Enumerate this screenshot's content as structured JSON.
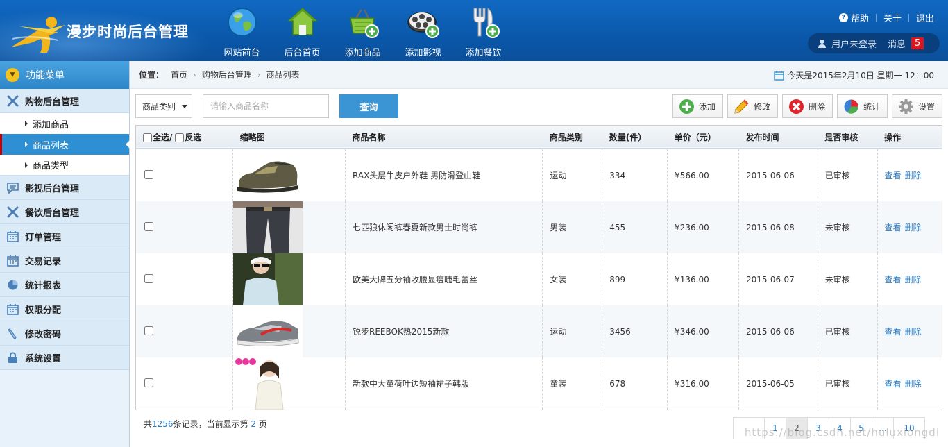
{
  "header": {
    "logo_text": "漫步时尚后台管理",
    "nav": [
      {
        "label": "网站前台",
        "icon": "globe-icon"
      },
      {
        "label": "后台首页",
        "icon": "house-icon"
      },
      {
        "label": "添加商品",
        "icon": "basket-add-icon"
      },
      {
        "label": "添加影视",
        "icon": "film-reel-add-icon"
      },
      {
        "label": "添加餐饮",
        "icon": "fork-knife-add-icon"
      }
    ],
    "top_links": {
      "help": "帮助",
      "about": "关于",
      "exit": "退出"
    },
    "user": {
      "status": "用户未登录",
      "messages_label": "消息",
      "messages_count": "5"
    }
  },
  "sidebar": {
    "title": "功能菜单",
    "groups": [
      {
        "label": "购物后台管理",
        "icon": "tools-icon"
      },
      {
        "label": "影视后台管理",
        "icon": "chat-icon"
      },
      {
        "label": "餐饮后台管理",
        "icon": "tools-icon"
      },
      {
        "label": "订单管理",
        "icon": "calendar-icon"
      },
      {
        "label": "交易记录",
        "icon": "calendar-icon"
      },
      {
        "label": "统计报表",
        "icon": "pie-icon"
      },
      {
        "label": "权限分配",
        "icon": "calendar-icon"
      },
      {
        "label": "修改密码",
        "icon": "pencil-icon"
      },
      {
        "label": "系统设置",
        "icon": "lock-icon"
      }
    ],
    "subitems": [
      "添加商品",
      "商品列表",
      "商品类型"
    ],
    "active_subitem": "商品列表"
  },
  "breadcrumb": {
    "label": "位置：",
    "items": [
      "首页",
      "购物后台管理",
      "商品列表"
    ],
    "date_text": "今天是2015年2月10日 星期一 12：00"
  },
  "toolbar": {
    "category_select": "商品类别",
    "search_placeholder": "请输入商品名称",
    "query_label": "查询",
    "buttons": [
      {
        "label": "添加",
        "icon": "plus-circle-icon"
      },
      {
        "label": "修改",
        "icon": "pencil-icon"
      },
      {
        "label": "删除",
        "icon": "delete-circle-icon"
      },
      {
        "label": "统计",
        "icon": "pie-chart-icon"
      },
      {
        "label": "设置",
        "icon": "gear-icon"
      }
    ]
  },
  "table": {
    "headers": {
      "select_all": "全选/",
      "invert": "反选",
      "thumb": "缩略图",
      "name": "商品名称",
      "category": "商品类别",
      "qty": "数量(件）",
      "price": "单价（元）",
      "date": "发布时间",
      "review": "是否审核",
      "ops": "操作"
    },
    "view_label": "查看",
    "delete_label": "删除",
    "rows": [
      {
        "name": "RAX头层牛皮户外鞋 男防滑登山鞋",
        "category": "运动",
        "qty": "334",
        "price": "¥566.00",
        "date": "2015-06-06",
        "review": "已审核"
      },
      {
        "name": "七匹狼休闲裤春夏新款男士时尚裤",
        "category": "男装",
        "qty": "455",
        "price": "¥236.00",
        "date": "2015-06-08",
        "review": "未审核"
      },
      {
        "name": "欧美大牌五分袖收腰显瘦睫毛蕾丝",
        "category": "女装",
        "qty": "899",
        "price": "¥136.00",
        "date": "2015-06-07",
        "review": "未审核"
      },
      {
        "name": "锐步REEBOK热2015新款",
        "category": "运动",
        "qty": "3456",
        "price": "¥346.00",
        "date": "2015-06-06",
        "review": "已审核"
      },
      {
        "name": "新款中大童荷叶边短袖裙子韩版",
        "category": "童装",
        "qty": "678",
        "price": "¥316.00",
        "date": "2015-06-05",
        "review": "已审核"
      }
    ]
  },
  "footer": {
    "prefix": "共",
    "total": "1256",
    "mid": "条记录，当前显示第",
    "page": "2",
    "suffix": "页",
    "pages": [
      "1",
      "2",
      "3",
      "4",
      "5",
      "...",
      "10"
    ],
    "current_page": "2",
    "watermark": "https://blog.csdn.net/huluxiongdi"
  }
}
